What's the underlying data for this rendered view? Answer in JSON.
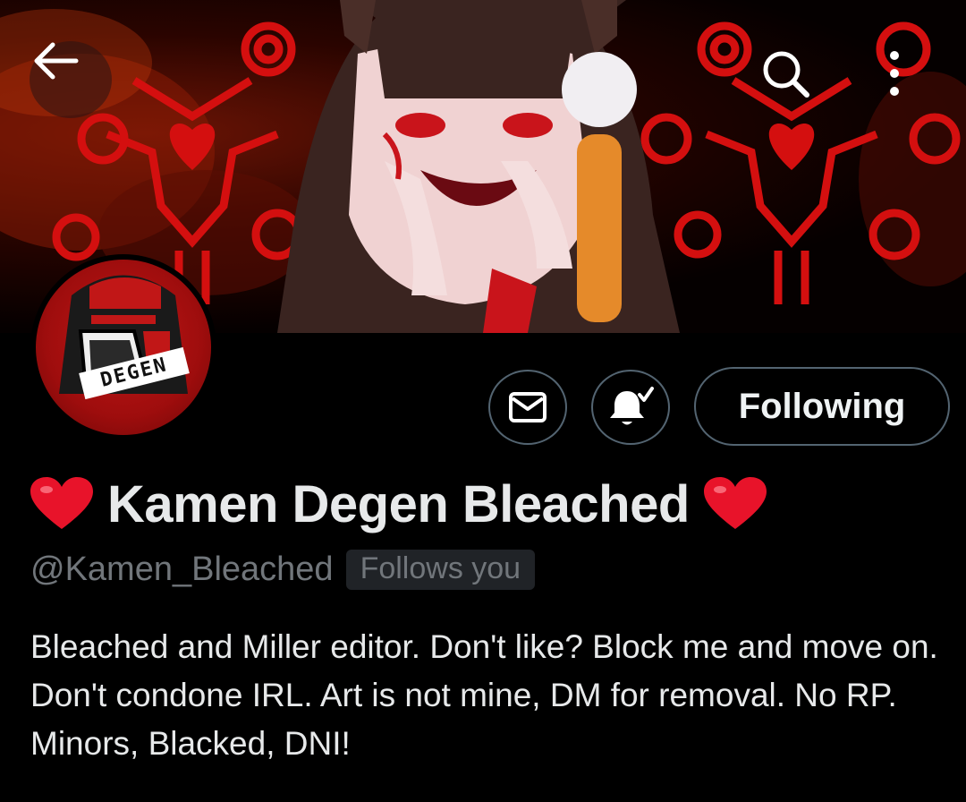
{
  "header": {
    "back_icon": "back-arrow-icon",
    "search_icon": "search-icon",
    "more_icon": "more-vertical-icon"
  },
  "banner": {
    "description_icon": "banner-art"
  },
  "avatar": {
    "label": "DEGEN"
  },
  "actions": {
    "message_icon": "envelope-icon",
    "notifications_icon": "bell-subscribed-icon",
    "following_label": "Following"
  },
  "profile": {
    "display_name": "Kamen Degen Bleached",
    "name_emoji": "❤️",
    "handle": "@Kamen_Bleached",
    "follows_you": "Follows you",
    "bio": "Bleached and Miller editor.  Don't like? Block me and move on. Don't condone IRL. Art is not mine, DM for removal. No RP. Minors, Blacked, DNI!"
  },
  "colors": {
    "background": "#000000",
    "text_primary": "#e7e9ea",
    "text_secondary": "#71767b",
    "border": "#536471",
    "accent_red": "#d40f0f"
  }
}
